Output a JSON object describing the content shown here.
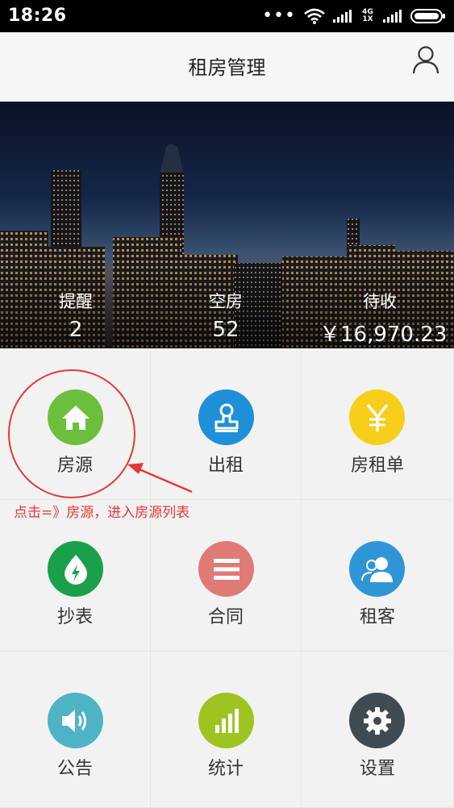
{
  "status_bar": {
    "time": "18:26",
    "network": "4G 1X"
  },
  "header": {
    "title": "租房管理",
    "user_icon": "person-icon"
  },
  "banner": {
    "stats": [
      {
        "label": "提醒",
        "value": "2"
      },
      {
        "label": "空房",
        "value": "52"
      },
      {
        "label": "待收",
        "value": "￥16,970.23"
      }
    ]
  },
  "grid": {
    "items": [
      {
        "label": "房源",
        "icon": "house-icon",
        "color": "#6cbf3c"
      },
      {
        "label": "出租",
        "icon": "stamp-icon",
        "color": "#1e90d8"
      },
      {
        "label": "房租单",
        "icon": "yen-icon",
        "color": "#f7cf1a"
      },
      {
        "label": "抄表",
        "icon": "water-drop-icon",
        "color": "#1aa04a"
      },
      {
        "label": "合同",
        "icon": "list-icon",
        "color": "#e07a76"
      },
      {
        "label": "租客",
        "icon": "people-icon",
        "color": "#2f96d6"
      },
      {
        "label": "公告",
        "icon": "speaker-icon",
        "color": "#4fb3c6"
      },
      {
        "label": "统计",
        "icon": "bar-chart-icon",
        "color": "#9fc421"
      },
      {
        "label": "设置",
        "icon": "gear-icon",
        "color": "#3f4b52"
      }
    ]
  },
  "annotation": {
    "text": "点击=》房源，进入房源列表",
    "color": "#e53935"
  }
}
